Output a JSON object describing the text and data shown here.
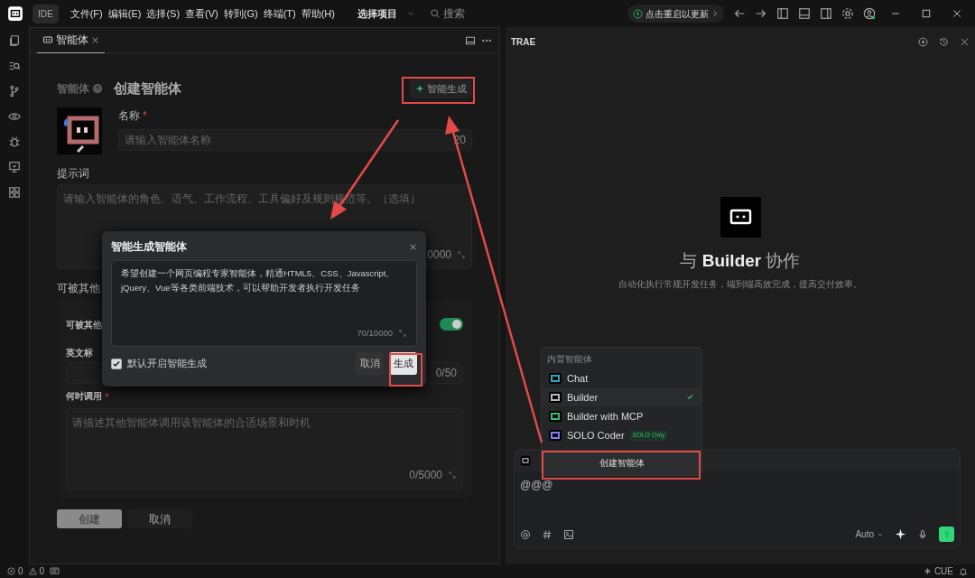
{
  "titlebar": {
    "app_label": "IDE",
    "menus": [
      "文件(F)",
      "编辑(E)",
      "选择(S)",
      "查看(V)",
      "转到(G)",
      "终端(T)",
      "帮助(H)"
    ],
    "project": "选择项目",
    "search_placeholder": "搜索",
    "update": "点击重启以更新"
  },
  "editor_tab": {
    "label": "智能体"
  },
  "form": {
    "breadcrumb": "智能体",
    "title": "创建智能体",
    "smart_button": "智能生成",
    "name_label": "名称",
    "name_required": "*",
    "name_placeholder": "请输入智能体名称",
    "name_counter": "20",
    "prompt_label": "提示词",
    "prompt_placeholder": "请输入智能体的角色、语气、工作流程、工具偏好及规则规范等。（选填）",
    "prompt_counter": "0000",
    "section_label": "可被其他",
    "toggle_label": "可被其他",
    "toggle_on": true,
    "english_label": "英文标",
    "english_counter": "0/50",
    "when_label": "何时调用",
    "when_required": "*",
    "when_placeholder": "请描述其他智能体调用该智能体的合适场景和时机",
    "when_counter": "0/5000",
    "create_button": "创建",
    "cancel_button": "取消"
  },
  "dialog": {
    "title": "智能生成智能体",
    "text": "希望创建一个网页编程专家智能体，精通HTML5、CSS、Javascript、jQuery、Vue等各类前端技术，可以帮助开发者执行开发任务",
    "counter": "70/10000",
    "default_label": "默认开启智能生成",
    "default_on": true,
    "cancel": "取消",
    "generate": "生成"
  },
  "chat_panel": {
    "title": "TRAE",
    "hero_title": "与 **Builder** 协作",
    "hero_subtitle": "自动化执行常规开发任务，端到端高效完成，提高交付效率。",
    "input_value": "@@@",
    "model": "Auto"
  },
  "agent_menu": {
    "header": "内置智能体",
    "items": [
      {
        "name": "Chat",
        "color": "#2aa7c9",
        "selected": false
      },
      {
        "name": "Builder",
        "color": "#b8b8b8",
        "selected": true
      },
      {
        "name": "Builder with MCP",
        "color": "#2fbf71",
        "selected": false
      },
      {
        "name": "SOLO Coder",
        "color": "#8b7cf6",
        "selected": false,
        "badge": "SOLO Only"
      }
    ],
    "create": "创建智能体"
  },
  "status_bar": {
    "errors": "0",
    "warnings": "0",
    "right": "CUE"
  }
}
